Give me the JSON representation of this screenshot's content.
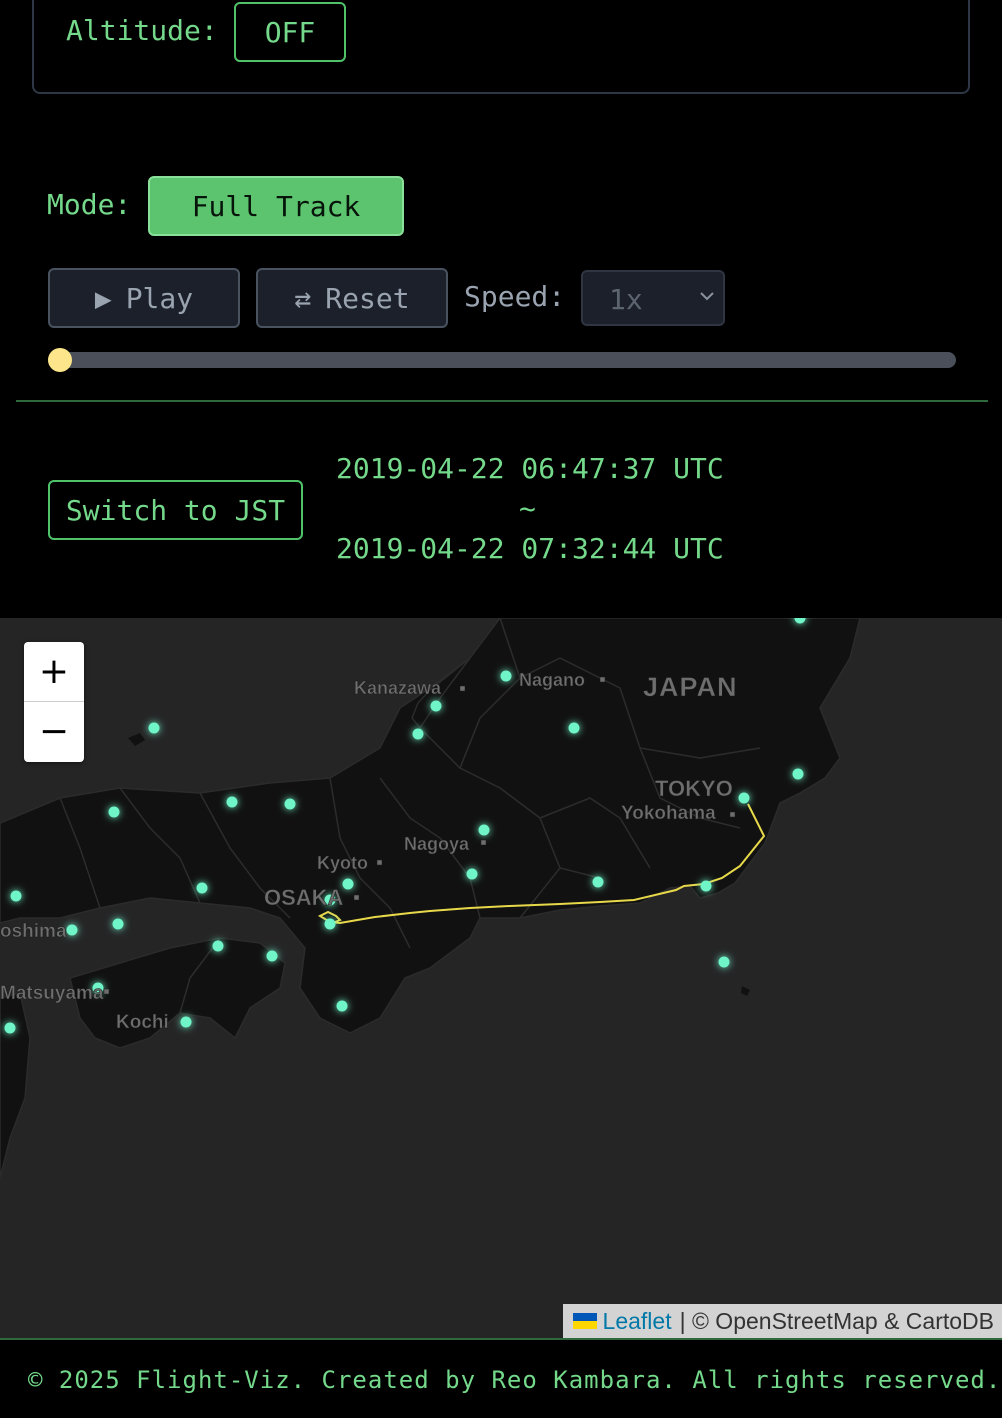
{
  "altitude": {
    "label": "Altitude:",
    "toggle": "OFF"
  },
  "mode": {
    "label": "Mode:",
    "value": "Full Track"
  },
  "controls": {
    "play_icon": "▶",
    "play_label": "Play",
    "reset_icon": "⇄",
    "reset_label": "Reset",
    "speed_label": "Speed:",
    "speed_value": "1x",
    "progress": 0
  },
  "time": {
    "switch_label": "Switch to JST",
    "start": "2019-04-22 06:47:37 UTC",
    "separator": "~",
    "end": "2019-04-22 07:32:44 UTC"
  },
  "map": {
    "zoom_in": "+",
    "zoom_out": "−",
    "labels": {
      "kanazawa": "Kanazawa",
      "nagano": "Nagano",
      "japan": "JAPAN",
      "tokyo": "TOKYO",
      "yokohama": "Yokohama",
      "kyoto": "Kyoto",
      "nagoya": "Nagoya",
      "osaka": "OSAKA",
      "hiroshima": "oshima",
      "matsuyama": "Matsuyama",
      "kochi": "Kochi"
    },
    "attribution": {
      "leaflet": "Leaflet",
      "rest": "| © OpenStreetMap & CartoDB"
    },
    "colors": {
      "airport": "#6ff5c8",
      "track": "#e8d94a",
      "land": "#111111",
      "sea": "#252526"
    }
  },
  "footer": "© 2025 Flight-Viz. Created by Reo Kambara. All rights reserved."
}
